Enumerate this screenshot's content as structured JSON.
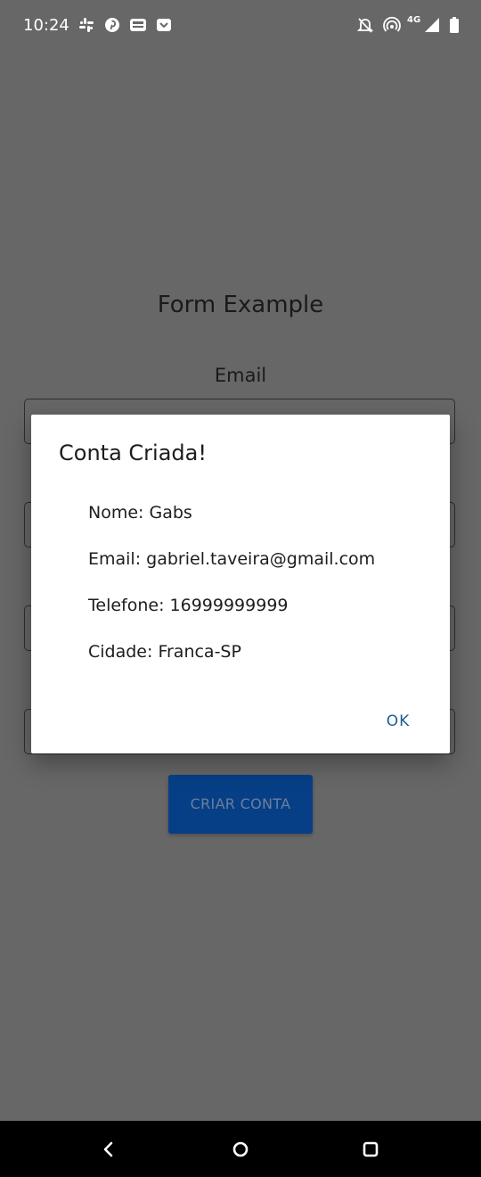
{
  "status_bar": {
    "time": "10:24",
    "network_label": "4G",
    "icons": [
      "slack-icon",
      "pinterest-icon",
      "ad-icon",
      "notification-icon",
      "mute-icon",
      "hotspot-icon",
      "signal-icon",
      "battery-icon"
    ]
  },
  "form": {
    "title": "Form Example",
    "email_label": "Email",
    "submit_label": "CRIAR CONTA"
  },
  "dialog": {
    "title": "Conta Criada!",
    "lines": [
      "Nome: Gabs",
      "Email: gabriel.taveira@gmail.com",
      "Telefone: 16999999999",
      "Cidade: Franca-SP"
    ],
    "ok_label": "OK"
  },
  "nav_bar": {
    "icons": [
      "back-icon",
      "home-icon",
      "recents-icon"
    ]
  },
  "colors": {
    "scrim_background": "#676767",
    "button_background": "#073f86",
    "dialog_action": "#1a5f8f",
    "dialog_background": "#ffffff"
  }
}
